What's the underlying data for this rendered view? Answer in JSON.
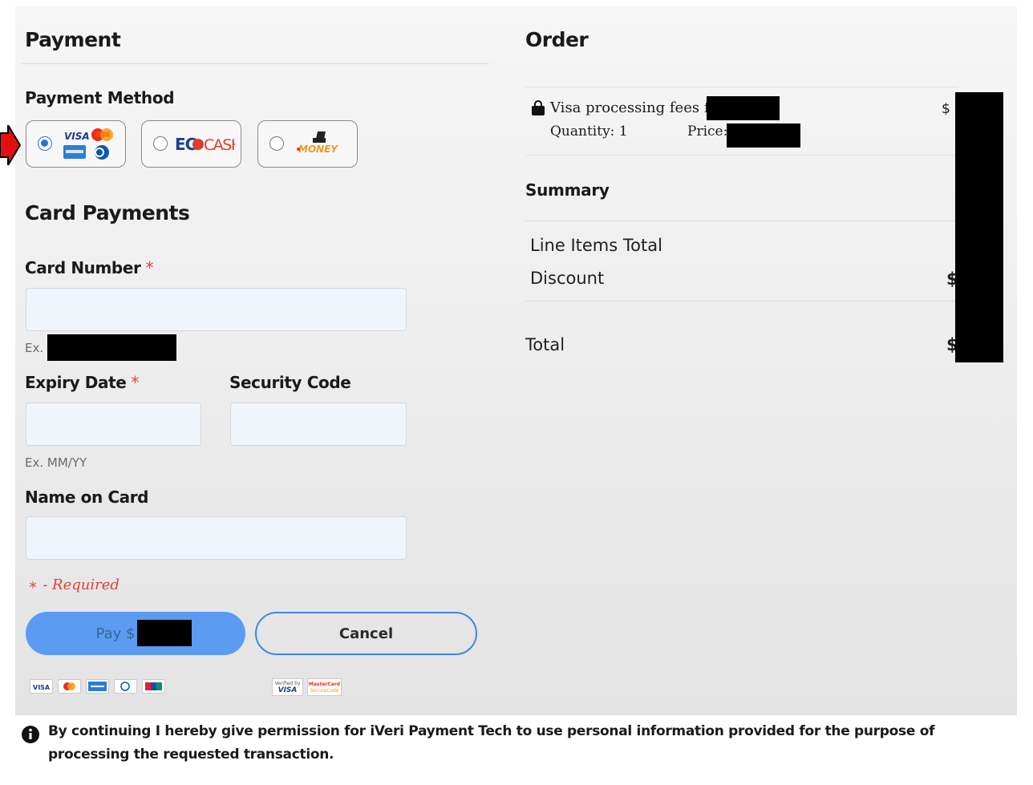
{
  "payment": {
    "title": "Payment",
    "method_label": "Payment Method",
    "methods": [
      {
        "name": "card",
        "label": "VISA",
        "selected": true
      },
      {
        "name": "ecocash",
        "label": "ECOCASH",
        "selected": false
      },
      {
        "name": "onemoney",
        "label": "MONEY",
        "selected": false
      }
    ],
    "card_title": "Card Payments",
    "card_number_label": "Card Number",
    "required_mark": "*",
    "card_number_value": "",
    "card_number_hint_prefix": "Ex.",
    "expiry_label": "Expiry Date",
    "expiry_value": "",
    "expiry_hint": "Ex. MM/YY",
    "security_label": "Security Code",
    "security_value": "",
    "name_label": "Name on Card",
    "name_value": "",
    "required_note_star": "∗",
    "required_note_text": "- Required",
    "pay_label": "Pay $",
    "cancel_label": "Cancel",
    "badge_verified_line1": "Verified by",
    "badge_verified_line2": "VISA",
    "badge_mc_line1": "MasterCard",
    "badge_mc_line2": "SecureCode"
  },
  "order": {
    "title": "Order",
    "item_name": "Visa processing fees for",
    "quantity_label": "Quantity:",
    "quantity_value": "1",
    "price_label": "Price:",
    "item_amount_prefix": "$",
    "summary_title": "Summary",
    "line_items_label": "Line Items Total",
    "discount_label": "Discount",
    "discount_prefix": "$",
    "total_label": "Total",
    "total_prefix": "$"
  },
  "consent": {
    "text": "By continuing I hereby give permission for iVeri Payment Tech to use personal information provided for the purpose of processing the requested transaction."
  },
  "colors": {
    "pay_button": "#5b9cf0",
    "cancel_border": "#3f86e8",
    "required": "#e0413a",
    "radio_selected": "#2d6fd6",
    "arrow": "#e01010"
  }
}
